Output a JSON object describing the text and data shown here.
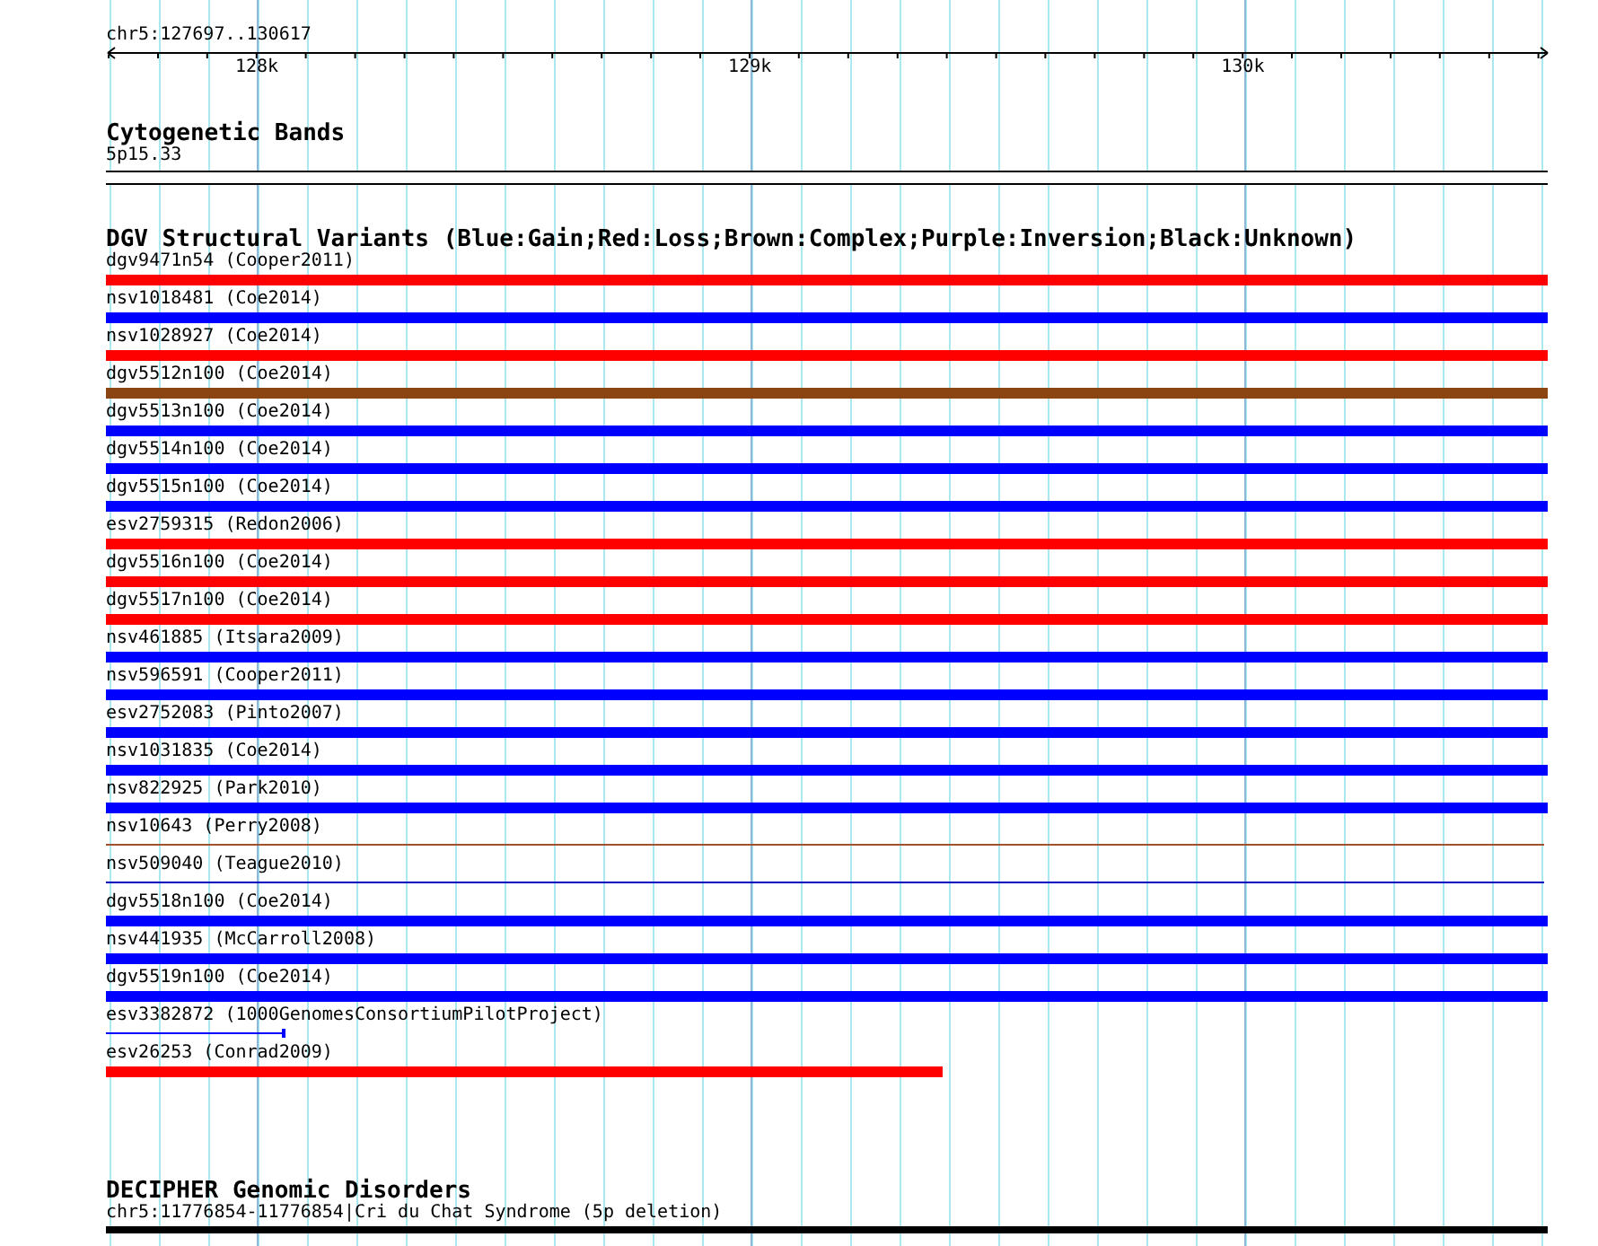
{
  "ruler": {
    "label": "chr5:127697..130617",
    "ticks": [
      "128k",
      "129k",
      "130k"
    ]
  },
  "tracks": [
    {
      "kind": "bands",
      "title": "Cytogenetic Bands",
      "features": [
        {
          "label": "5p15.33",
          "kind": "band",
          "level": 1
        }
      ]
    },
    {
      "kind": "variants",
      "title": "DGV Structural Variants (Blue:Gain;Red:Loss;Brown:Complex;Purple:Inversion;Black:Unknown)",
      "features": [
        {
          "label": "dgv9471n54 (Cooper2011)",
          "kind": "bar",
          "color": "#ff0000",
          "level": 1
        },
        {
          "label": "nsv1018481 (Coe2014)",
          "kind": "bar",
          "color": "#0000ff",
          "level": 1
        },
        {
          "label": "nsv1028927 (Coe2014)",
          "kind": "bar",
          "color": "#ff0000",
          "level": 1
        },
        {
          "label": "dgv5512n100 (Coe2014)",
          "kind": "bar",
          "color": "#8b4513",
          "level": 1
        },
        {
          "label": "dgv5513n100 (Coe2014)",
          "kind": "bar",
          "color": "#0000ff",
          "level": 1
        },
        {
          "label": "dgv5514n100 (Coe2014)",
          "kind": "bar",
          "color": "#0000ff",
          "level": 1
        },
        {
          "label": "dgv5515n100 (Coe2014)",
          "kind": "bar",
          "color": "#0000ff",
          "level": 1
        },
        {
          "label": "esv2759315 (Redon2006)",
          "kind": "bar",
          "color": "#ff0000",
          "level": 1
        },
        {
          "label": "dgv5516n100 (Coe2014)",
          "kind": "bar",
          "color": "#ff0000",
          "level": 1
        },
        {
          "label": "dgv5517n100 (Coe2014)",
          "kind": "bar",
          "color": "#ff0000",
          "level": 1
        },
        {
          "label": "nsv461885 (Itsara2009)",
          "kind": "bar",
          "color": "#0000ff",
          "level": 1
        },
        {
          "label": "nsv596591 (Cooper2011)",
          "kind": "bar",
          "color": "#0000ff",
          "level": 1
        },
        {
          "label": "esv2752083 (Pinto2007)",
          "kind": "bar",
          "color": "#0000ff",
          "level": 1
        },
        {
          "label": "nsv1031835 (Coe2014)",
          "kind": "bar",
          "color": "#0000ff",
          "level": 1
        },
        {
          "label": "nsv822925 (Park2010)",
          "kind": "bar",
          "color": "#0000ff",
          "level": 1
        },
        {
          "label": "nsv10643 (Perry2008)",
          "kind": "line",
          "color": "#a0522d",
          "level": 1
        },
        {
          "label": "nsv509040 (Teague2010)",
          "kind": "line",
          "color": "#0000c0",
          "level": 1
        },
        {
          "label": "dgv5518n100 (Coe2014)",
          "kind": "bar",
          "color": "#0000ff",
          "level": 1
        },
        {
          "label": "nsv441935 (McCarroll2008)",
          "kind": "bar",
          "color": "#0000ff",
          "level": 1
        },
        {
          "label": "dgv5519n100 (Coe2014)",
          "kind": "bar",
          "color": "#0000ff",
          "level": 1
        },
        {
          "label": "esv3382872 (1000GenomesConsortiumPilotProject)",
          "kind": "line",
          "color": "#0000ff",
          "level": 0.124
        },
        {
          "label": "esv26253 (Conrad2009)",
          "kind": "bar",
          "color": "#ff0000",
          "level": 0.58
        }
      ]
    },
    {
      "kind": "disorders",
      "title": "DECIPHER Genomic Disorders",
      "features": [
        {
          "label": "chr5:11776854-11776854|Cri du Chat Syndrome (5p deletion)",
          "kind": "bar",
          "color": "#000000",
          "level": 1
        }
      ]
    }
  ]
}
